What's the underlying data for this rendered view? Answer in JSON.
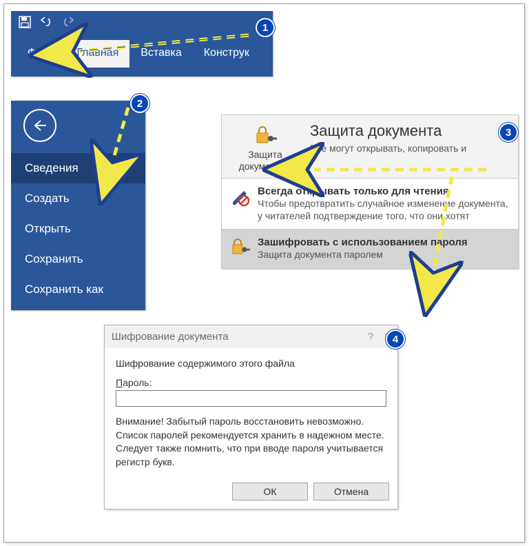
{
  "ribbon": {
    "tabs": [
      "Файл",
      "Главная",
      "Вставка",
      "Конструк"
    ],
    "active_index": 1
  },
  "backstage": {
    "items": [
      "Сведения",
      "Создать",
      "Открыть",
      "Сохранить",
      "Сохранить как"
    ],
    "selected_index": 0
  },
  "protect": {
    "button_line1": "Защита",
    "button_line2": "документа",
    "title": "Защита документа",
    "subtitle": "Все могут открывать, копировать и",
    "rows": [
      {
        "title": "Всегда открывать только для чтения",
        "desc": "Чтобы предотвратить случайное изменение документа, у читателей подтверждение того, что они хотят"
      },
      {
        "title": "Зашифровать с использованием пароля",
        "desc": "Защита документа паролем"
      }
    ]
  },
  "dialog": {
    "title": "Шифрование документа",
    "heading": "Шифрование содержимого этого файла",
    "password_label_u": "П",
    "password_label_rest": "ароль:",
    "password_value": "",
    "warning": "Внимание! Забытый пароль восстановить невозможно. Список паролей рекомендуется хранить в надежном месте.\nСледует также помнить, что при вводе пароля учитывается регистр букв.",
    "ok": "ОК",
    "cancel": "Отмена"
  },
  "badges": [
    "1",
    "2",
    "3",
    "4"
  ]
}
